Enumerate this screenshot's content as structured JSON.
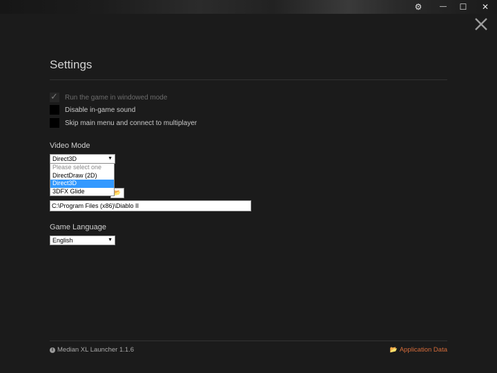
{
  "titlebar": {
    "buttons": [
      {
        "name": "gear-icon",
        "glyph": "⚙"
      },
      {
        "name": "minimize-icon",
        "glyph": "—"
      },
      {
        "name": "maximize-icon",
        "glyph": "☐"
      },
      {
        "name": "close-icon",
        "glyph": "✕"
      }
    ]
  },
  "page": {
    "title": "Settings"
  },
  "options": [
    {
      "label": "Run the game in windowed mode",
      "checked": true,
      "disabled": true
    },
    {
      "label": "Disable in-game sound",
      "checked": false,
      "disabled": false
    },
    {
      "label": "Skip main menu and connect to multiplayer",
      "checked": false,
      "disabled": false
    }
  ],
  "video_mode": {
    "label": "Video Mode",
    "selected": "Direct3D",
    "options": [
      "Please select one",
      "DirectDraw (2D)",
      "Direct3D",
      "3DFX Glide"
    ]
  },
  "game_path": {
    "value": "C:\\Program Files (x86)\\Diablo II",
    "browse_glyph": "📂"
  },
  "game_language": {
    "label": "Game Language",
    "selected": "English"
  },
  "footer": {
    "version": "Median XL Launcher 1.1.6",
    "app_data_link": "Application Data"
  },
  "colors": {
    "background": "#1b1b1b",
    "accent": "#d46b3a",
    "selection": "#3399ff"
  }
}
